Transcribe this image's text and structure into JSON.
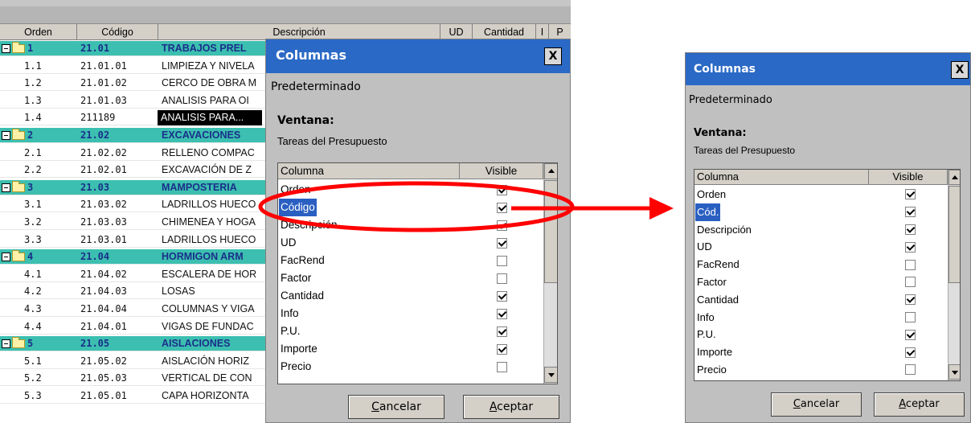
{
  "grid": {
    "headers": {
      "orden": "Orden",
      "codigo": "Código",
      "descripcion": "Descripción",
      "ud": "UD",
      "cantidad": "Cantidad",
      "i": "I",
      "p": "P"
    },
    "rows": [
      {
        "type": "group",
        "orden": "1",
        "codigo": "21.01",
        "descripcion": "TRABAJOS PREL"
      },
      {
        "type": "item",
        "orden": "1.1",
        "codigo": "21.01.01",
        "descripcion": "LIMPIEZA Y NIVELA"
      },
      {
        "type": "item",
        "orden": "1.2",
        "codigo": "21.01.02",
        "descripcion": "CERCO DE OBRA M"
      },
      {
        "type": "item",
        "orden": "1.3",
        "codigo": "21.01.03",
        "descripcion": "ANALISIS PARA OI"
      },
      {
        "type": "selected",
        "orden": "1.4",
        "codigo": "211189",
        "descripcion": "ANALISIS PARA..."
      },
      {
        "type": "group",
        "orden": "2",
        "codigo": "21.02",
        "descripcion": "EXCAVACIONES"
      },
      {
        "type": "item",
        "orden": "2.1",
        "codigo": "21.02.02",
        "descripcion": "RELLENO COMPAC"
      },
      {
        "type": "item",
        "orden": "2.2",
        "codigo": "21.02.01",
        "descripcion": "EXCAVACIÓN DE Z"
      },
      {
        "type": "group",
        "orden": "3",
        "codigo": "21.03",
        "descripcion": "MAMPOSTERIA"
      },
      {
        "type": "item",
        "orden": "3.1",
        "codigo": "21.03.02",
        "descripcion": "LADRILLOS HUECO"
      },
      {
        "type": "item",
        "orden": "3.2",
        "codigo": "21.03.03",
        "descripcion": "CHIMENEA Y HOGA"
      },
      {
        "type": "item",
        "orden": "3.3",
        "codigo": "21.03.01",
        "descripcion": "LADRILLOS HUECO"
      },
      {
        "type": "group",
        "orden": "4",
        "codigo": "21.04",
        "descripcion": "HORMIGON ARM"
      },
      {
        "type": "item",
        "orden": "4.1",
        "codigo": "21.04.02",
        "descripcion": "ESCALERA DE HOR"
      },
      {
        "type": "item",
        "orden": "4.2",
        "codigo": "21.04.03",
        "descripcion": "LOSAS"
      },
      {
        "type": "item",
        "orden": "4.3",
        "codigo": "21.04.04",
        "descripcion": "COLUMNAS Y VIGA"
      },
      {
        "type": "item",
        "orden": "4.4",
        "codigo": "21.04.01",
        "descripcion": "VIGAS DE FUNDAC"
      },
      {
        "type": "group",
        "orden": "5",
        "codigo": "21.05",
        "descripcion": "AISLACIONES"
      },
      {
        "type": "item",
        "orden": "5.1",
        "codigo": "21.05.02",
        "descripcion": "AISLACIÓN HORIZ"
      },
      {
        "type": "item",
        "orden": "5.2",
        "codigo": "21.05.03",
        "descripcion": "VERTICAL DE CON"
      },
      {
        "type": "item",
        "orden": "5.3",
        "codigo": "21.05.01",
        "descripcion": "CAPA HORIZONTA"
      }
    ]
  },
  "dialog_left": {
    "title": "Columnas",
    "close": "X",
    "preset": "Predeterminado",
    "ventana_label": "Ventana:",
    "ventana_value": "Tareas del Presupuesto",
    "col_header": "Columna",
    "vis_header": "Visible",
    "rows": [
      {
        "name": "Orden",
        "visible": true
      },
      {
        "name": "Código",
        "visible": true,
        "selected": true
      },
      {
        "name": "Descripción",
        "visible": true
      },
      {
        "name": "UD",
        "visible": true
      },
      {
        "name": "FacRend",
        "visible": false
      },
      {
        "name": "Factor",
        "visible": false
      },
      {
        "name": "Cantidad",
        "visible": true
      },
      {
        "name": "Info",
        "visible": true
      },
      {
        "name": "P.U.",
        "visible": true
      },
      {
        "name": "Importe",
        "visible": true
      },
      {
        "name": "Precio",
        "visible": false
      }
    ],
    "cancel_prefix": "C",
    "cancel_rest": "ancelar",
    "accept_prefix": "A",
    "accept_rest": "ceptar"
  },
  "dialog_right": {
    "title": "Columnas",
    "close": "X",
    "preset": "Predeterminado",
    "ventana_label": "Ventana:",
    "ventana_value": "Tareas del Presupuesto",
    "col_header": "Columna",
    "vis_header": "Visible",
    "rows": [
      {
        "name": "Orden",
        "visible": true
      },
      {
        "name": "Cód.",
        "visible": true,
        "selected": true
      },
      {
        "name": "Descripción",
        "visible": true
      },
      {
        "name": "UD",
        "visible": true
      },
      {
        "name": "FacRend",
        "visible": false
      },
      {
        "name": "Factor",
        "visible": false
      },
      {
        "name": "Cantidad",
        "visible": true
      },
      {
        "name": "Info",
        "visible": false
      },
      {
        "name": "P.U.",
        "visible": true
      },
      {
        "name": "Importe",
        "visible": true
      },
      {
        "name": "Precio",
        "visible": false
      }
    ],
    "cancel_prefix": "C",
    "cancel_rest": "ancelar",
    "accept_prefix": "A",
    "accept_rest": "ceptar"
  },
  "colors": {
    "title_bar": "#2a69c5",
    "group_row": "#3cbfb0",
    "group_text": "#1a2f8a",
    "annotation": "#ff0000"
  }
}
